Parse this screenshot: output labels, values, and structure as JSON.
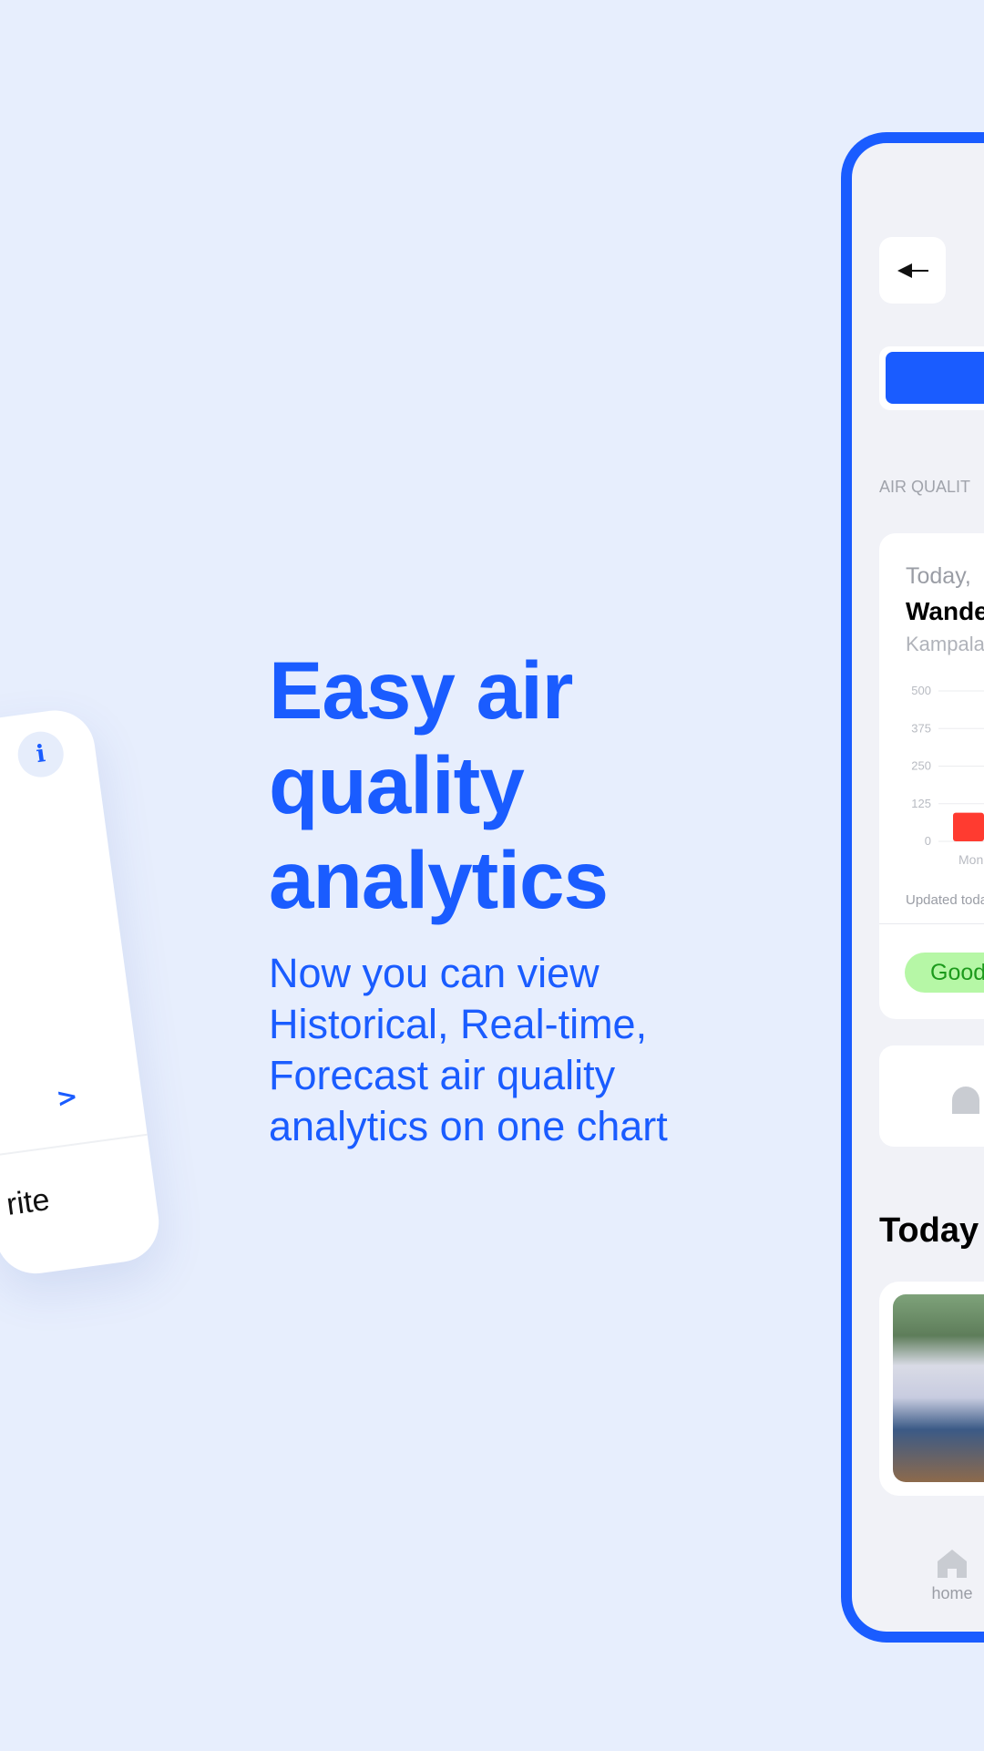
{
  "promo": {
    "headline": "Easy air quality analytics",
    "subtitle": "Now you can view Historical, Real-time, Forecast air quality analytics on one chart"
  },
  "left_card": {
    "info_icon": "info-icon",
    "chevron_icon": "chevron-right-icon",
    "favorite_text": "rite"
  },
  "phone": {
    "back_icon": "arrow-left-icon",
    "section_label": "AIR QUALIT",
    "card": {
      "date": "Today,",
      "place": "Wande",
      "region": "Kampala",
      "updated": "Updated toda",
      "status": "Good"
    },
    "chart_data": {
      "type": "bar",
      "categories": [
        "Mon"
      ],
      "values": [
        95
      ],
      "y_ticks": [
        "500",
        "375",
        "250",
        "125",
        "0"
      ],
      "ylim": [
        0,
        500
      ],
      "bar_color": "#ff3b30"
    },
    "today_heading": "Today",
    "nav": {
      "home": "home"
    }
  },
  "colors": {
    "accent": "#1a5cff",
    "background": "#e7eefd",
    "good_bg": "#b6f7a6",
    "good_text": "#1c9a1c"
  }
}
